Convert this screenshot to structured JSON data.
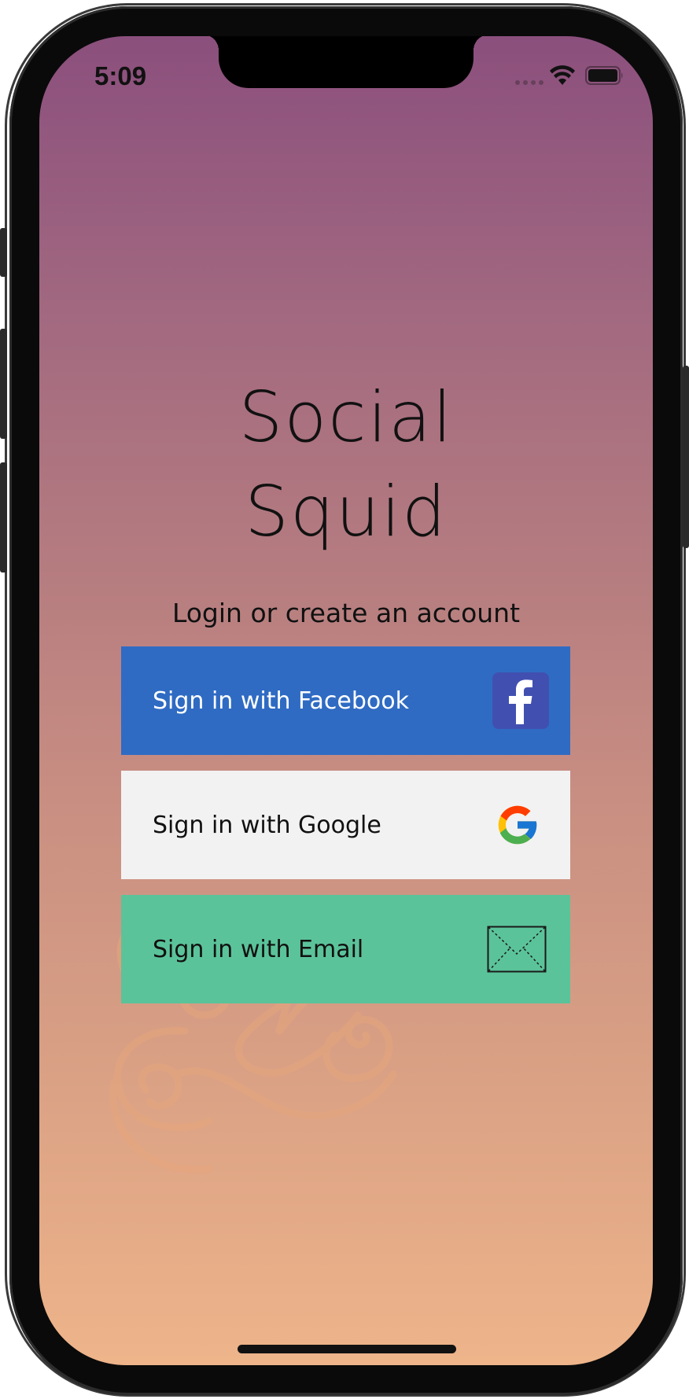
{
  "status_bar": {
    "time": "5:09",
    "icons": [
      "cellular-dots-icon",
      "wifi-icon",
      "battery-icon"
    ]
  },
  "app": {
    "title_line1": "Social",
    "title_line2": "Squid",
    "subtitle": "Login or create an account"
  },
  "buttons": {
    "facebook": {
      "label": "Sign in with Facebook",
      "icon": "facebook-icon",
      "color": "#2f6bc3"
    },
    "google": {
      "label": "Sign in with Google",
      "icon": "google-icon",
      "color": "#f2f2f2"
    },
    "email": {
      "label": "Sign in with Email",
      "icon": "mail-icon",
      "color": "#5bc39a"
    }
  },
  "theme": {
    "gradient_top": "#8b4f7d",
    "gradient_bottom": "#eeb48a"
  }
}
